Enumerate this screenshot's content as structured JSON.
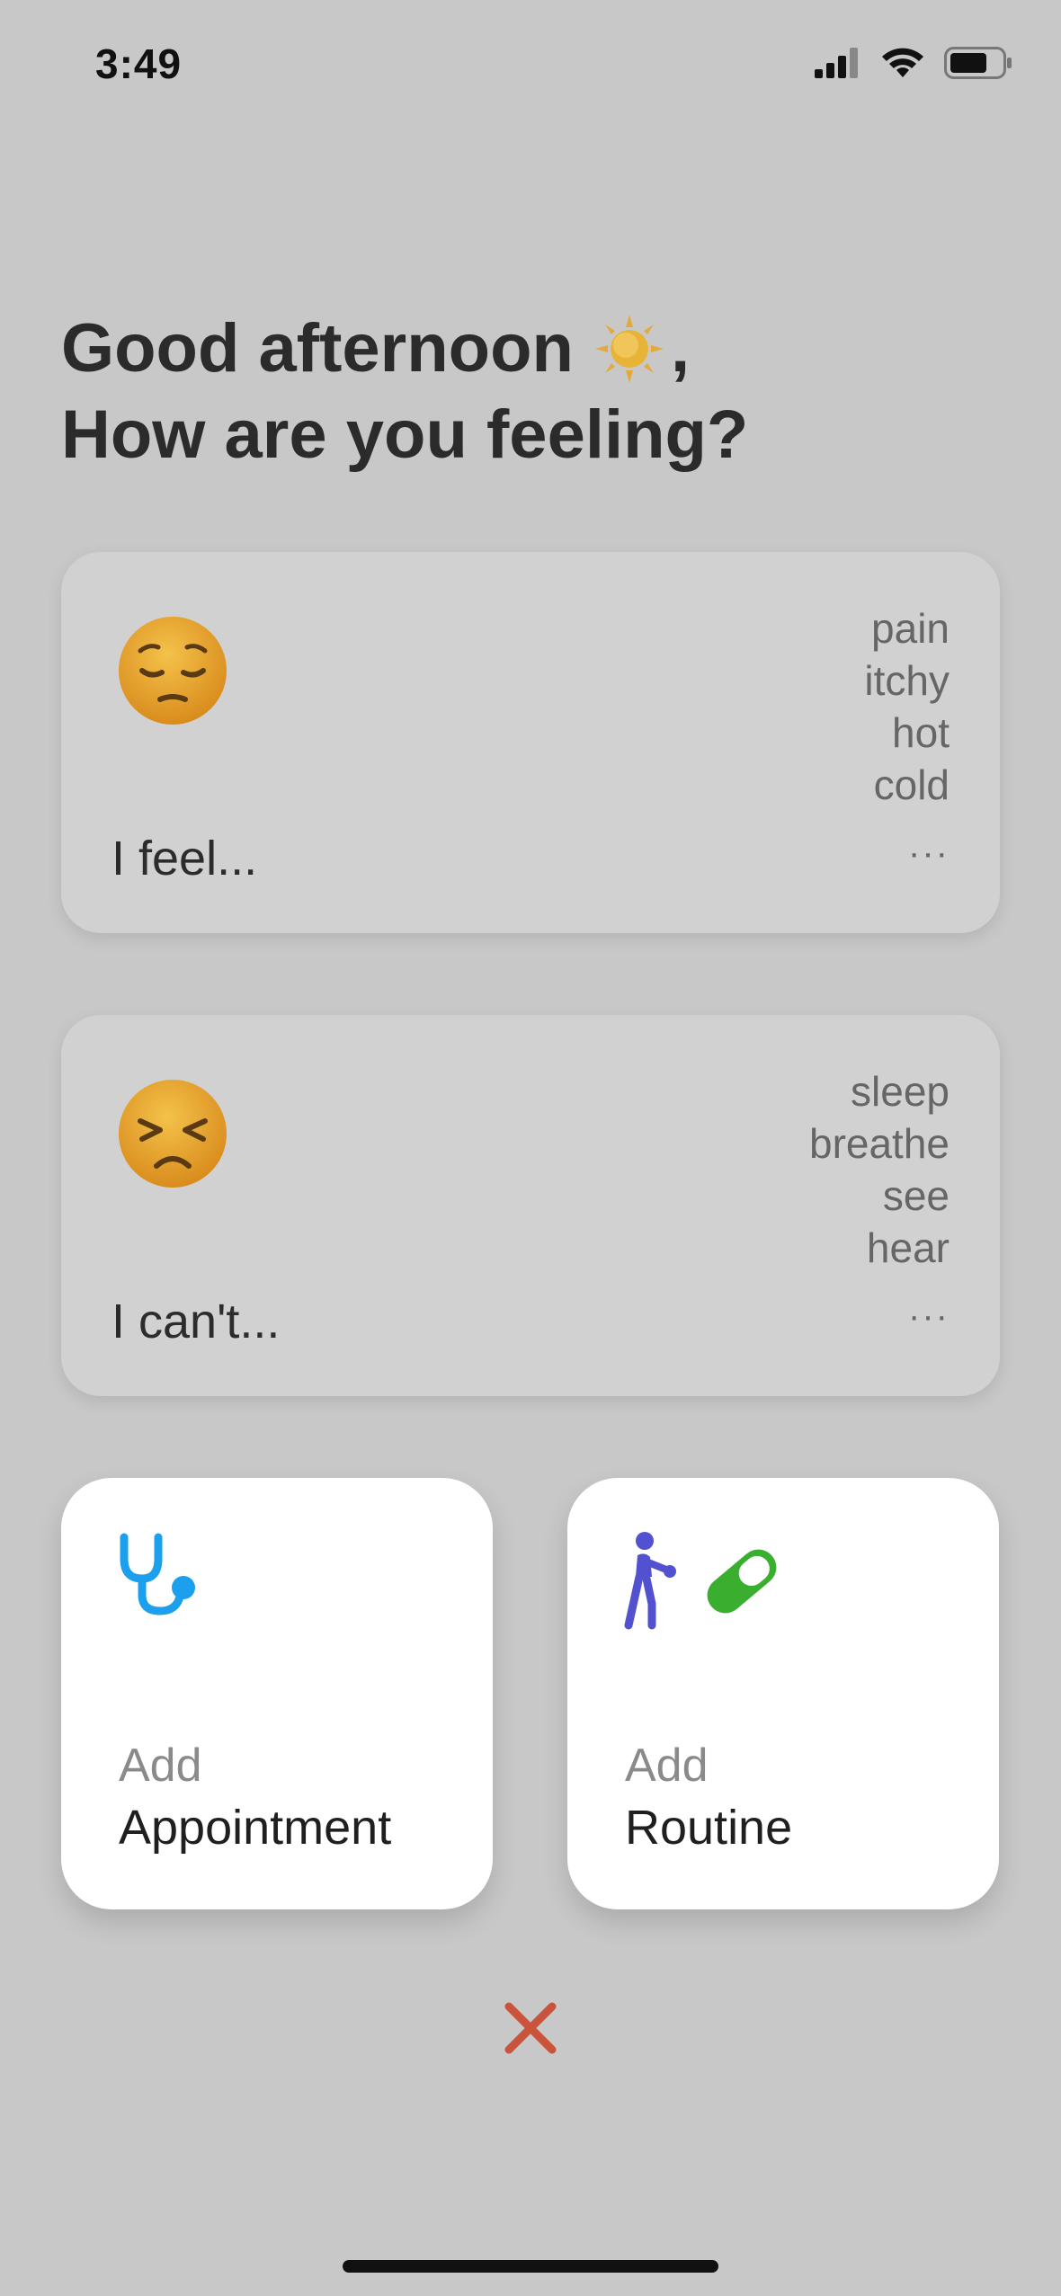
{
  "status_bar": {
    "time": "3:49",
    "icons": [
      "cellular-signal-icon",
      "wifi-icon",
      "battery-icon"
    ]
  },
  "greeting": {
    "line1": "Good afternoon",
    "line1_suffix": ",",
    "line2": "How are you feeling?",
    "icon": "sun-icon"
  },
  "cards": {
    "feel": {
      "label": "I feel...",
      "emoji": "pensive-face",
      "options": [
        "pain",
        "itchy",
        "hot",
        "cold"
      ],
      "more": "···"
    },
    "cant": {
      "label": "I can't...",
      "emoji": "persevering-face",
      "options": [
        "sleep",
        "breathe",
        "see",
        "hear"
      ],
      "more": "···"
    }
  },
  "actions": {
    "appointment": {
      "prefix": "Add",
      "title": "Appointment",
      "icons": [
        "stethoscope-icon"
      ],
      "icon_color": "#1ca0ee"
    },
    "routine": {
      "prefix": "Add",
      "title": "Routine",
      "icons": [
        "exercise-figure-icon",
        "pill-icon"
      ],
      "icon_colors": [
        "#5251cf",
        "#3aae2f"
      ]
    }
  },
  "close": {
    "icon": "close-icon",
    "color": "#c9543b"
  },
  "colors": {
    "background": "#c8c8c8",
    "card": "#d1d1d1",
    "action_card": "#ffffff"
  }
}
